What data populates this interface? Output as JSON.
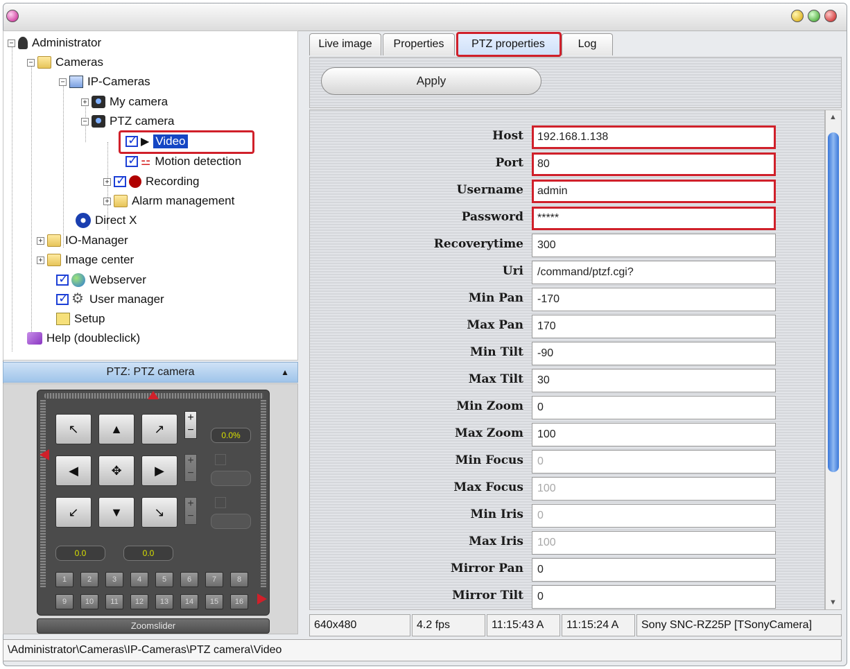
{
  "tree": {
    "administrator": "Administrator",
    "cameras": "Cameras",
    "ip_cameras": "IP-Cameras",
    "my_camera": "My camera",
    "ptz_camera": "PTZ camera",
    "video": "Video",
    "motion_detection": "Motion detection",
    "recording": "Recording",
    "alarm_management": "Alarm management",
    "direct_x": "Direct X",
    "io_manager": "IO-Manager",
    "image_center": "Image center",
    "webserver": "Webserver",
    "user_manager": "User manager",
    "setup": "Setup",
    "help": "Help (doubleclick)"
  },
  "ptz": {
    "header": "PTZ: PTZ camera",
    "zoom_display": "0.0%",
    "pan_display": "0.0",
    "tilt_display": "0.0",
    "presets": [
      "1",
      "2",
      "3",
      "4",
      "5",
      "6",
      "7",
      "8",
      "9",
      "10",
      "11",
      "12",
      "13",
      "14",
      "15",
      "16"
    ],
    "zoomslider": "Zoomslider"
  },
  "tabs": [
    "Live image",
    "Properties",
    "PTZ properties",
    "Log"
  ],
  "toolbar": {
    "apply": "Apply"
  },
  "properties": [
    {
      "label": "Host",
      "value": "192.168.1.138"
    },
    {
      "label": "Port",
      "value": "80"
    },
    {
      "label": "Username",
      "value": "admin"
    },
    {
      "label": "Password",
      "value": "*****"
    },
    {
      "label": "Recoverytime",
      "value": "300"
    },
    {
      "label": "Uri",
      "value": "/command/ptzf.cgi?"
    },
    {
      "label": "Min Pan",
      "value": "-170"
    },
    {
      "label": "Max Pan",
      "value": "170"
    },
    {
      "label": "Min Tilt",
      "value": "-90"
    },
    {
      "label": "Max Tilt",
      "value": "30"
    },
    {
      "label": "Min Zoom",
      "value": "0"
    },
    {
      "label": "Max Zoom",
      "value": "100"
    },
    {
      "label": "Min Focus",
      "value": "0"
    },
    {
      "label": "Max Focus",
      "value": "100"
    },
    {
      "label": "Min Iris",
      "value": "0"
    },
    {
      "label": "Max Iris",
      "value": "100"
    },
    {
      "label": "Mirror Pan",
      "value": "0"
    },
    {
      "label": "Mirror Tilt",
      "value": "0"
    }
  ],
  "status": {
    "resolution": "640x480",
    "fps": "4.2 fps",
    "time1": "11:15:43 A",
    "time2": "11:15:24 A",
    "camera": "Sony SNC-RZ25P [TSonyCamera]"
  },
  "path": "\\Administrator\\Cameras\\IP-Cameras\\PTZ camera\\Video",
  "colors": {
    "highlight": "#d0202a",
    "selection": "#1446c4",
    "accent": "#3a77d8"
  }
}
